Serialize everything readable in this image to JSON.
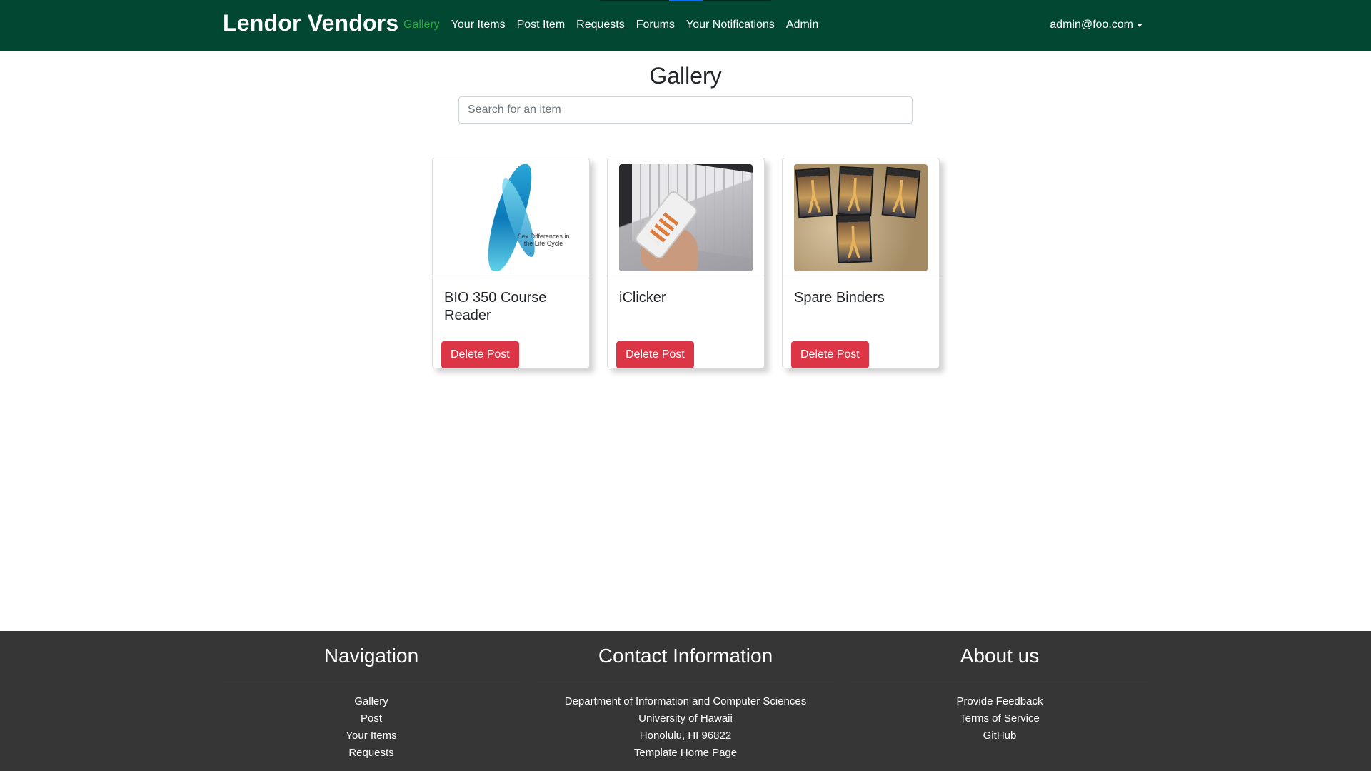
{
  "navbar": {
    "brand": "Lendor Vendors",
    "links": [
      {
        "label": "Gallery",
        "active": true
      },
      {
        "label": "Your Items",
        "active": false
      },
      {
        "label": "Post Item",
        "active": false
      },
      {
        "label": "Requests",
        "active": false
      },
      {
        "label": "Forums",
        "active": false
      },
      {
        "label": "Your Notifications",
        "active": false
      },
      {
        "label": "Admin",
        "active": false
      }
    ],
    "user": "admin@foo.com",
    "background_color": "#024731",
    "active_link_color": "#28a745"
  },
  "main": {
    "title": "Gallery",
    "search": {
      "placeholder": "Search for an item",
      "value": ""
    },
    "cards": [
      {
        "title": "BIO 350 Course Reader",
        "image": "book-cover-image",
        "image_text": "Sex Differences in the Life Cycle",
        "button": "Delete Post"
      },
      {
        "title": "iClicker",
        "image": "clicker-photo-image",
        "button": "Delete Post"
      },
      {
        "title": "Spare Binders",
        "image": "binders-photo-image",
        "button": "Delete Post"
      }
    ],
    "delete_button_color": "#dc3545"
  },
  "footer": {
    "background_color": "#363636",
    "navigation": {
      "heading": "Navigation",
      "links": [
        "Gallery",
        "Post",
        "Your Items",
        "Requests"
      ]
    },
    "contact": {
      "heading": "Contact Information",
      "lines": [
        "Department of Information and Computer Sciences",
        "University of Hawaii",
        "Honolulu, HI 96822"
      ],
      "link": "Template Home Page"
    },
    "about": {
      "heading": "About us",
      "links": [
        "Provide Feedback",
        "Terms of Service",
        "GitHub"
      ]
    }
  }
}
